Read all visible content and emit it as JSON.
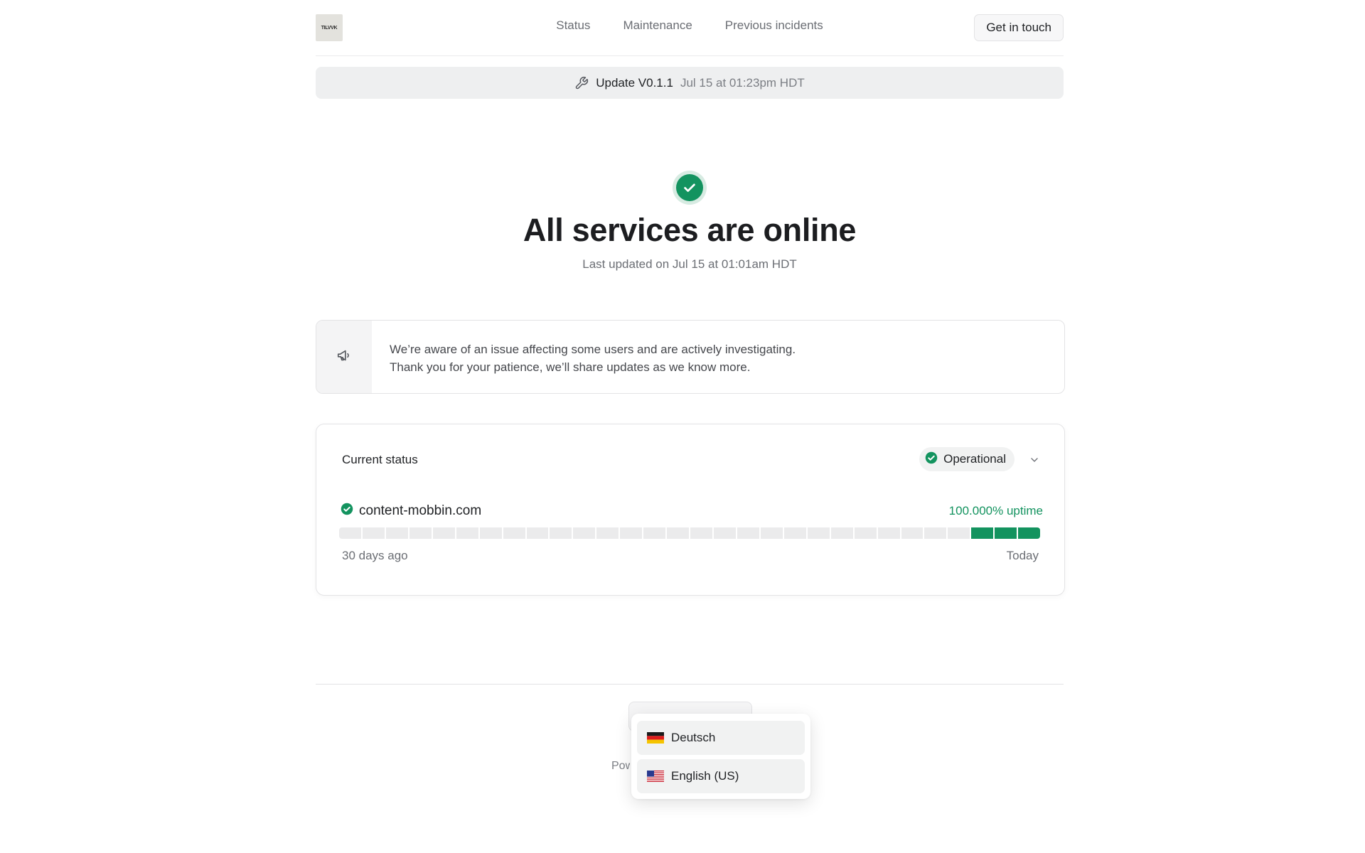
{
  "header": {
    "logo_text": "TILVVK",
    "nav": [
      "Status",
      "Maintenance",
      "Previous incidents"
    ],
    "contact_label": "Get in touch"
  },
  "banner": {
    "icon": "wrench-icon",
    "title": "Update V0.1.1",
    "time": "Jul 15 at 01:23pm HDT"
  },
  "hero": {
    "icon": "check-circle-icon",
    "title": "All services are online",
    "subtitle": "Last updated on Jul 15 at 01:01am HDT"
  },
  "notice": {
    "icon": "megaphone-icon",
    "line1": "We’re aware of an issue affecting some users and are actively investigating.",
    "line2": "Thank you for your patience, we’ll share updates as we know more."
  },
  "status": {
    "title": "Current status",
    "pill": "Operational",
    "service_name": "content-mobbin.com",
    "uptime": "100.000% uptime",
    "range_start": "30 days ago",
    "range_end": "Today",
    "days_total": 30,
    "days_with_data": 3,
    "colors": {
      "ok": "#13935f",
      "no_data": "#ebebec"
    }
  },
  "footer": {
    "powered_text": "Powered by",
    "languages": [
      {
        "flag": "germany-flag-icon",
        "label": "Deutsch"
      },
      {
        "flag": "us-flag-icon",
        "label": "English (US)"
      }
    ]
  }
}
